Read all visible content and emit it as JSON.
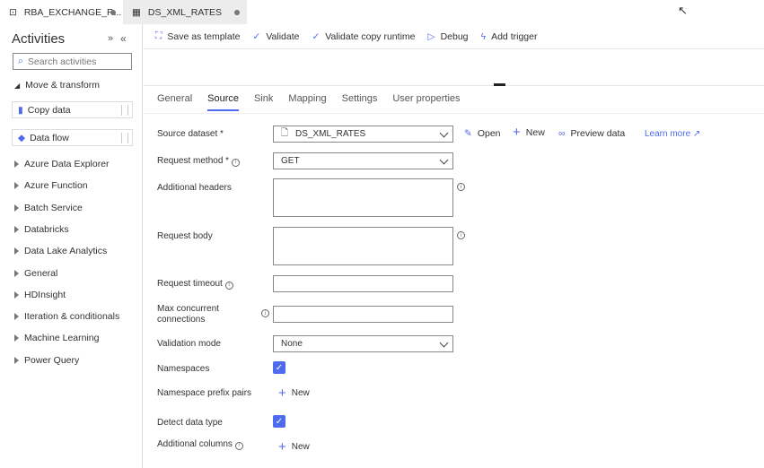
{
  "tabs": [
    {
      "label": "RBA_EXCHANGE_R...",
      "icon": "pipeline-icon",
      "unsaved": true
    },
    {
      "label": "DS_XML_RATES",
      "icon": "table-icon",
      "unsaved": true
    }
  ],
  "sidebar": {
    "title": "Activities",
    "search_placeholder": "Search activities",
    "section": "Move & transform",
    "cards": [
      {
        "label": "Copy data",
        "icon": "copy-data-icon"
      },
      {
        "label": "Data flow",
        "icon": "data-flow-icon"
      }
    ],
    "items": [
      "Azure Data Explorer",
      "Azure Function",
      "Batch Service",
      "Databricks",
      "Data Lake Analytics",
      "General",
      "HDInsight",
      "Iteration & conditionals",
      "Machine Learning",
      "Power Query"
    ]
  },
  "toolbar": {
    "save_template": "Save as template",
    "validate": "Validate",
    "validate_copy": "Validate copy runtime",
    "debug": "Debug",
    "add_trigger": "Add trigger"
  },
  "prop_tabs": [
    "General",
    "Source",
    "Sink",
    "Mapping",
    "Settings",
    "User properties"
  ],
  "active_tab": "Source",
  "form": {
    "source_dataset": {
      "label": "Source dataset",
      "value": "DS_XML_RATES",
      "open": "Open",
      "new": "New",
      "preview": "Preview data",
      "learn": "Learn more"
    },
    "request_method": {
      "label": "Request method",
      "value": "GET"
    },
    "additional_headers": {
      "label": "Additional headers",
      "value": ""
    },
    "request_body": {
      "label": "Request body",
      "value": ""
    },
    "request_timeout": {
      "label": "Request timeout",
      "value": ""
    },
    "max_concurrent": {
      "label1": "Max concurrent",
      "label2": "connections",
      "value": ""
    },
    "validation_mode": {
      "label": "Validation mode",
      "value": "None"
    },
    "namespaces": {
      "label": "Namespaces",
      "checked": true
    },
    "ns_prefix": {
      "label": "Namespace prefix pairs",
      "new": "New"
    },
    "detect": {
      "label": "Detect data type",
      "checked": true
    },
    "additional_columns": {
      "label": "Additional columns",
      "new": "New"
    }
  },
  "accent": "#4f6bed"
}
